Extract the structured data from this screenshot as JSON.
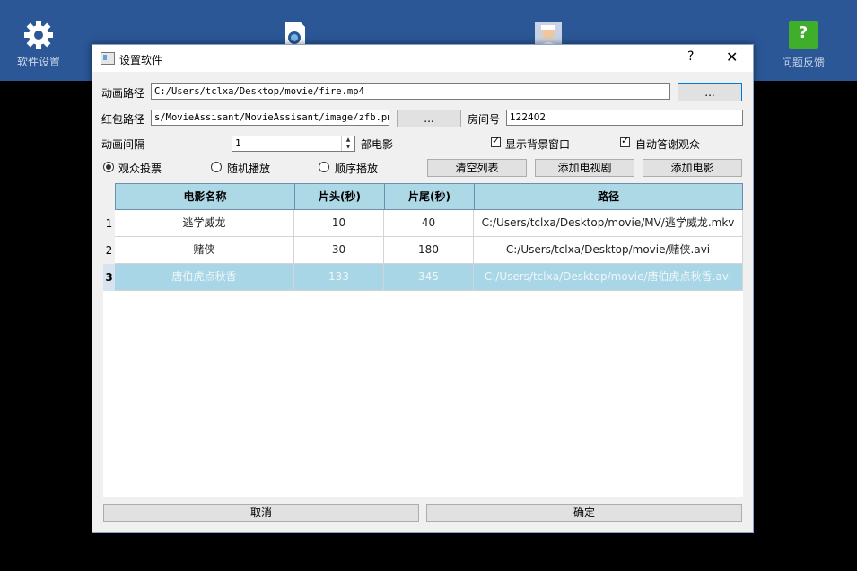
{
  "topbar": {
    "items": [
      {
        "label": "软件设置"
      },
      {
        "label": ""
      },
      {
        "label": ""
      },
      {
        "label": "问题反馈"
      }
    ]
  },
  "dialog": {
    "title": "设置软件",
    "help": "?",
    "close": "✕",
    "anim_path_label": "动画路径",
    "anim_path_value": "C:/Users/tclxa/Desktop/movie/fire.mp4",
    "anim_browse": "...",
    "hb_path_label": "红包路径",
    "hb_path_value": "s/MovieAssisant/MovieAssisant/image/zfb.png",
    "hb_browse": "...",
    "room_label": "房间号",
    "room_value": "122402",
    "interval_label": "动画间隔",
    "interval_value": "1",
    "interval_unit": "部电影",
    "show_bg_label": "显示背景窗口",
    "auto_thanks_label": "自动答谢观众",
    "radio_vote": "观众投票",
    "radio_random": "随机播放",
    "radio_order": "顺序播放",
    "clear_list": "清空列表",
    "add_tv": "添加电视剧",
    "add_movie": "添加电影",
    "cancel": "取消",
    "ok": "确定"
  },
  "table": {
    "headers": [
      "电影名称",
      "片头(秒)",
      "片尾(秒)",
      "路径"
    ],
    "rows": [
      {
        "num": "1",
        "name": "逃学威龙",
        "head": "10",
        "tail": "40",
        "path": "C:/Users/tclxa/Desktop/movie/MV/逃学威龙.mkv"
      },
      {
        "num": "2",
        "name": "赌侠",
        "head": "30",
        "tail": "180",
        "path": "C:/Users/tclxa/Desktop/movie/赌侠.avi"
      },
      {
        "num": "3",
        "name": "唐伯虎点秋香",
        "head": "133",
        "tail": "345",
        "path": "C:/Users/tclxa/Desktop/movie/唐伯虎点秋香.avi"
      }
    ]
  }
}
